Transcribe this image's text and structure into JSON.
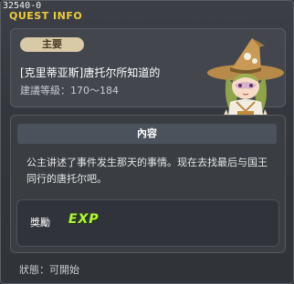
{
  "window": {
    "quest_id": "32540-0",
    "title": "QUEST INFO"
  },
  "header": {
    "badge": "主要",
    "quest_name": "[克里蒂亚斯]唐托尔所知道的",
    "level_requirement": "建議等級：170～184"
  },
  "content": {
    "heading": "內容",
    "text": "公主讲述了事件发生那天的事情。现在去找最后与国王同行的唐托尔吧。"
  },
  "reward": {
    "label": "獎勵",
    "exp_text": "EXP"
  },
  "status": {
    "text": "狀態：可開始"
  },
  "colors": {
    "title_accent": "#f0c93a",
    "badge_bg": "#d8c9a7",
    "exp_green": "#b7f43a",
    "panel_bg": "#43474d"
  },
  "icons": [
    "npc-portrait-witch"
  ]
}
